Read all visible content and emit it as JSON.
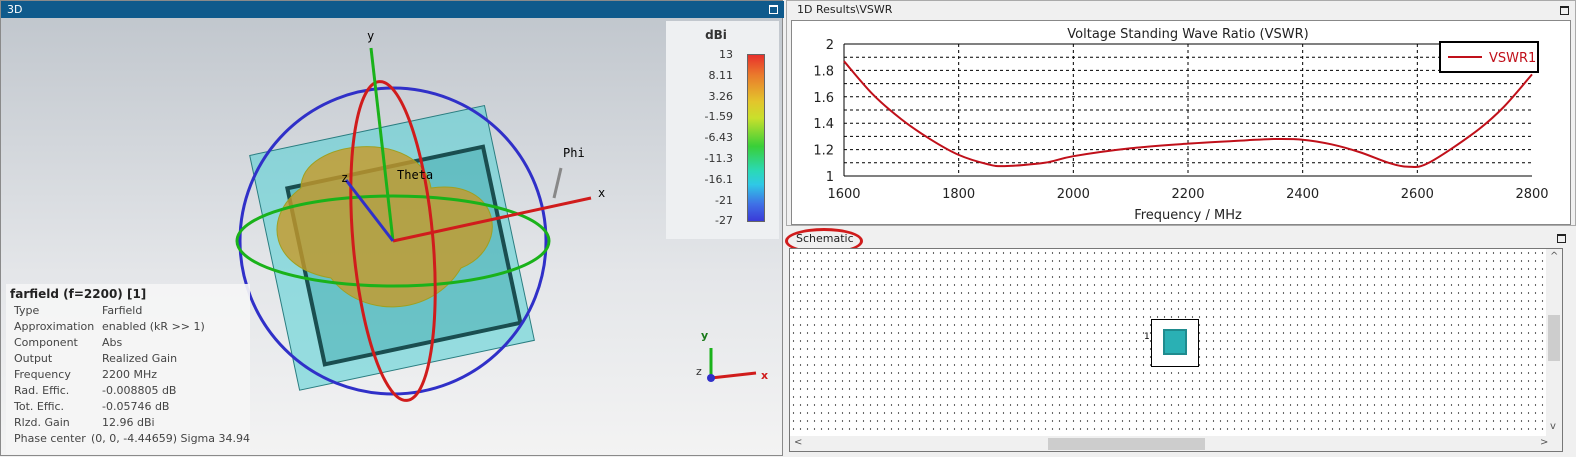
{
  "left_panel": {
    "title": "3D",
    "axes": {
      "x": "x",
      "y": "y",
      "z": "z",
      "theta": "Theta",
      "phi": "Phi"
    },
    "legend": {
      "unit": "dBi",
      "ticks": [
        "13",
        "8.11",
        "3.26",
        "-1.59",
        "-6.43",
        "-11.3",
        "-16.1",
        "-21",
        "-27"
      ]
    },
    "info": {
      "heading": "farfield (f=2200) [1]",
      "rows": [
        {
          "k": "Type",
          "v": "Farfield"
        },
        {
          "k": "Approximation",
          "v": "enabled (kR >> 1)"
        },
        {
          "k": "Component",
          "v": "Abs"
        },
        {
          "k": "Output",
          "v": "Realized Gain"
        },
        {
          "k": "Frequency",
          "v": "2200 MHz"
        },
        {
          "k": "Rad. Effic.",
          "v": "-0.008805 dB"
        },
        {
          "k": "Tot. Effic.",
          "v": "-0.05746 dB"
        },
        {
          "k": "Rlzd. Gain",
          "v": "12.96 dBi"
        },
        {
          "k": "Phase center",
          "v": "(0, 0, -4.44659) Sigma 34.94"
        }
      ]
    },
    "triad": {
      "x": "x",
      "y": "y",
      "z": "z"
    }
  },
  "results_panel": {
    "title": "1D Results\\VSWR"
  },
  "schematic_panel": {
    "title": "Schematic",
    "port_label": "1"
  },
  "chart_data": {
    "type": "line",
    "title": "Voltage Standing Wave Ratio (VSWR)",
    "xlabel": "Frequency / MHz",
    "ylabel": "",
    "xlim": [
      1600,
      2800
    ],
    "ylim": [
      1,
      2
    ],
    "xticks": [
      "1600",
      "1800",
      "2000",
      "2200",
      "2400",
      "2600",
      "2800"
    ],
    "yticks": [
      "1",
      "1.2",
      "1.4",
      "1.6",
      "1.8",
      "2"
    ],
    "grid": true,
    "legend_position": "top-right",
    "series": [
      {
        "name": "VSWR1",
        "color": "#c0101a",
        "x": [
          1600,
          1650,
          1700,
          1750,
          1800,
          1850,
          1880,
          1950,
          2000,
          2100,
          2200,
          2300,
          2350,
          2400,
          2450,
          2500,
          2550,
          2585,
          2620,
          2700,
          2750,
          2800
        ],
        "y": [
          1.87,
          1.62,
          1.43,
          1.28,
          1.16,
          1.09,
          1.075,
          1.1,
          1.15,
          1.21,
          1.245,
          1.27,
          1.28,
          1.275,
          1.24,
          1.18,
          1.1,
          1.07,
          1.1,
          1.33,
          1.52,
          1.77
        ]
      }
    ]
  }
}
